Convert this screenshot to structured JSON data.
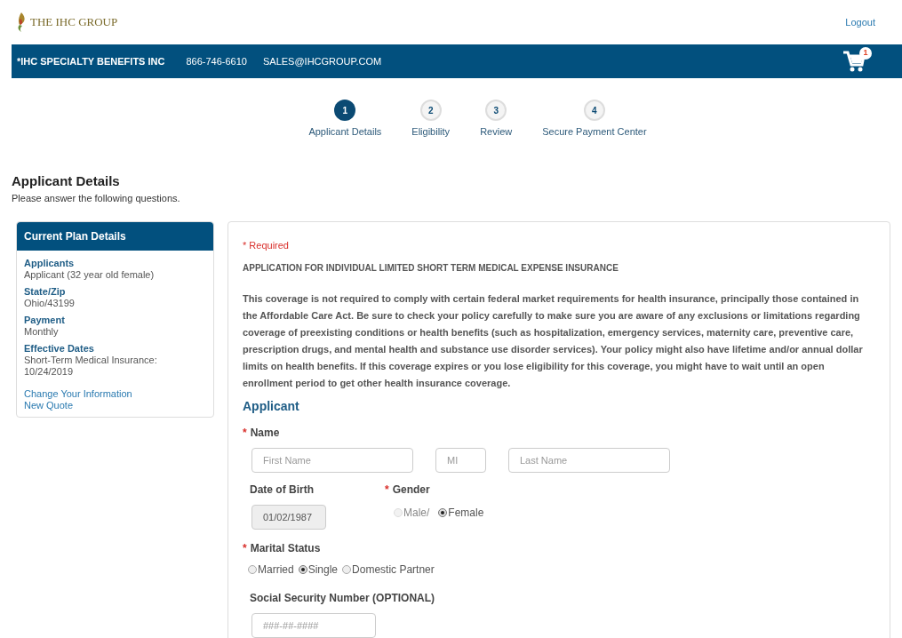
{
  "header": {
    "logo": "THE IHC GROUP",
    "logout": "Logout"
  },
  "navbar": {
    "company": "*IHC SPECIALTY BENEFITS INC",
    "phone": "866-746-6610",
    "email": "SALES@IHCGROUP.COM",
    "cart_count": "1"
  },
  "steps": [
    {
      "number": "1",
      "label": "Applicant Details",
      "selected": true
    },
    {
      "number": "2",
      "label": "Eligibility",
      "selected": false
    },
    {
      "number": "3",
      "label": "Review",
      "selected": false
    },
    {
      "number": "4",
      "label": "Secure Payment Center",
      "selected": false
    }
  ],
  "page": {
    "title": "Applicant Details",
    "subtitle": "Please answer the following questions."
  },
  "sidebar": {
    "title": "Current Plan Details",
    "details": [
      {
        "label": "Applicants",
        "value": "Applicant (32 year old female)"
      },
      {
        "label": "State/Zip",
        "value": "Ohio/43199"
      },
      {
        "label": "Payment",
        "value": "Monthly"
      },
      {
        "label": "Effective Dates",
        "value": "Short-Term Medical Insurance: 10/24/2019"
      }
    ],
    "links": [
      "Change Your Information",
      "New Quote"
    ]
  },
  "form": {
    "required_note": "* Required",
    "heading": "APPLICATION FOR INDIVIDUAL LIMITED SHORT TERM MEDICAL EXPENSE INSURANCE",
    "disclaimer": "This coverage is not required to comply with certain federal market requirements for health insurance, principally those contained in the Affordable Care Act. Be sure to check your policy carefully to make sure you are aware of any exclusions or limitations regarding coverage of preexisting conditions or health benefits (such as hospitalization, emergency services, maternity care, preventive care, prescription drugs, and mental health and substance use disorder services). Your policy might also have lifetime and/or annual dollar limits on health benefits. If this coverage expires or you lose eligibility for this coverage, you might have to wait until an open enrollment period to get other health insurance coverage.",
    "section": "Applicant",
    "required_mark": "*",
    "name": {
      "label": "Name",
      "required": true,
      "fields": [
        {
          "placeholder": "First Name"
        },
        {
          "placeholder": "MI"
        },
        {
          "placeholder": "Last Name"
        }
      ]
    },
    "dob": {
      "label": "Date of Birth",
      "required": false,
      "value": "01/02/1987",
      "disabled": true
    },
    "gender": {
      "label": "Gender",
      "required": true,
      "options": [
        {
          "label": "Male/",
          "selected": false,
          "disabled": true
        },
        {
          "label": "Female",
          "selected": true,
          "disabled": false
        }
      ]
    },
    "marital": {
      "label": "Marital Status",
      "required": true,
      "options": [
        {
          "label": "Married",
          "selected": false,
          "disabled": false
        },
        {
          "label": "Single",
          "selected": true,
          "disabled": false
        },
        {
          "label": "Domestic Partner",
          "selected": false,
          "disabled": false
        }
      ]
    },
    "ssn": {
      "label": "Social Security Number (OPTIONAL)",
      "required": false,
      "placeholder": "###-##-####"
    }
  }
}
